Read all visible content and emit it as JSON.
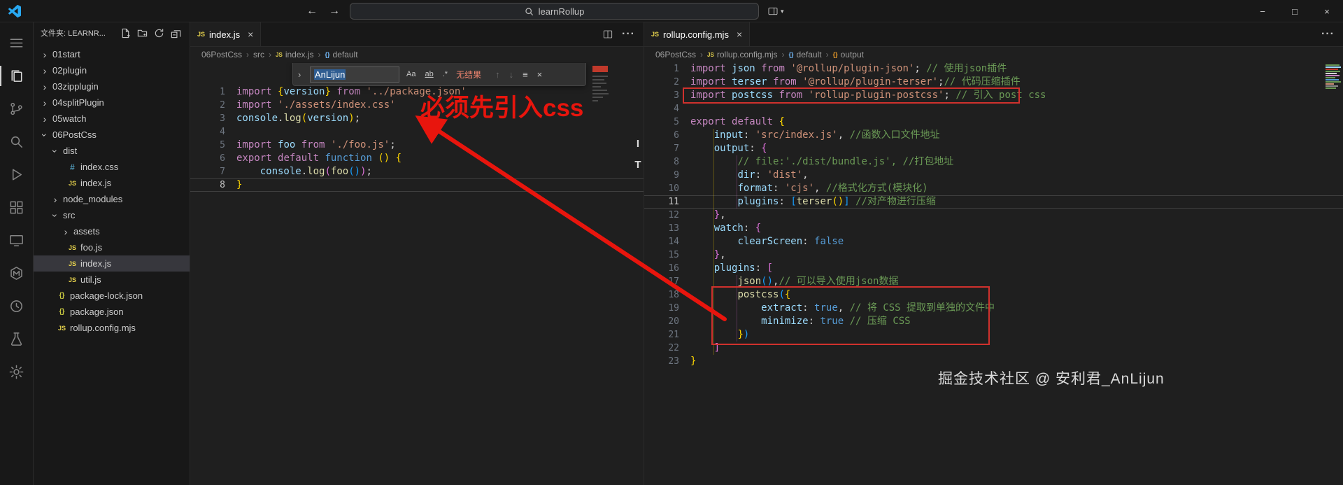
{
  "icons": {
    "back": "←",
    "forward": "→",
    "chevron": "›",
    "chevron_down": "▾",
    "dots": "···",
    "close": "×",
    "find_prev": "↑",
    "find_next": "↓",
    "find_selection": "≡",
    "match_case": "Aa",
    "whole_word": "ab",
    "regex": ".*",
    "minimize": "−",
    "maximize": "□",
    "window_close": "×",
    "scroll_mark_1": "I",
    "scroll_mark_2": "T",
    "js_badge": "JS",
    "css_badge": "#",
    "json_badge": "{}",
    "sym_badge": "{}"
  },
  "titlebar": {
    "search_value": "learnRollup"
  },
  "activity_bar": {
    "items": [
      "menu-icon",
      "explorer-icon",
      "source-control-icon",
      "search-icon",
      "run-debug-icon",
      "extensions-icon",
      "remote-explorer-icon",
      "extension-hex-m-icon",
      "extension-circle-icon",
      "testing-icon",
      "settings-gear-icon"
    ]
  },
  "explorer": {
    "header": "文件夹: LEARNR...",
    "tree": [
      {
        "label": "01start",
        "level": 0,
        "kind": "folder",
        "expanded": false
      },
      {
        "label": "02plugin",
        "level": 0,
        "kind": "folder",
        "expanded": false
      },
      {
        "label": "03zipplugin",
        "level": 0,
        "kind": "folder",
        "expanded": false
      },
      {
        "label": "04splitPlugin",
        "level": 0,
        "kind": "folder",
        "expanded": false
      },
      {
        "label": "05watch",
        "level": 0,
        "kind": "folder",
        "expanded": false
      },
      {
        "label": "06PostCss",
        "level": 0,
        "kind": "folder",
        "expanded": true
      },
      {
        "label": "dist",
        "level": 1,
        "kind": "folder",
        "expanded": true
      },
      {
        "label": "index.css",
        "level": 2,
        "kind": "file",
        "icon": "css"
      },
      {
        "label": "index.js",
        "level": 2,
        "kind": "file",
        "icon": "js"
      },
      {
        "label": "node_modules",
        "level": 1,
        "kind": "folder",
        "expanded": false
      },
      {
        "label": "src",
        "level": 1,
        "kind": "folder",
        "expanded": true
      },
      {
        "label": "assets",
        "level": 2,
        "kind": "folder",
        "expanded": false
      },
      {
        "label": "foo.js",
        "level": 2,
        "kind": "file",
        "icon": "js"
      },
      {
        "label": "index.js",
        "level": 2,
        "kind": "file",
        "icon": "js",
        "selected": true
      },
      {
        "label": "util.js",
        "level": 2,
        "kind": "file",
        "icon": "js"
      },
      {
        "label": "package-lock.json",
        "level": 1,
        "kind": "file",
        "icon": "json"
      },
      {
        "label": "package.json",
        "level": 1,
        "kind": "file",
        "icon": "json"
      },
      {
        "label": "rollup.config.mjs",
        "level": 1,
        "kind": "file",
        "icon": "js"
      }
    ]
  },
  "left_editor": {
    "tab": "index.js",
    "breadcrumbs": [
      {
        "label": "06PostCss"
      },
      {
        "label": "src"
      },
      {
        "label": "index.js",
        "icon": "js"
      },
      {
        "label": "default",
        "icon": "sym"
      }
    ],
    "find": {
      "query": "AnLijun",
      "status": "无结果"
    },
    "current_line": 8,
    "lines": [
      {
        "n": 1,
        "s": [
          [
            "kw",
            "import "
          ],
          [
            "b1",
            "{"
          ],
          [
            "id",
            "version"
          ],
          [
            "b1",
            "}"
          ],
          [
            "pln",
            " "
          ],
          [
            "kw",
            "from"
          ],
          [
            "pln",
            " "
          ],
          [
            "str",
            "'../package.json'"
          ]
        ]
      },
      {
        "n": 2,
        "s": [
          [
            "kw",
            "import "
          ],
          [
            "str",
            "'./assets/index.css'"
          ]
        ]
      },
      {
        "n": 3,
        "s": [
          [
            "id",
            "console"
          ],
          [
            "pln",
            "."
          ],
          [
            "fn",
            "log"
          ],
          [
            "b1",
            "("
          ],
          [
            "id",
            "version"
          ],
          [
            "b1",
            ")"
          ],
          [
            "pln",
            ";"
          ]
        ]
      },
      {
        "n": 4,
        "s": []
      },
      {
        "n": 5,
        "s": [
          [
            "kw",
            "import "
          ],
          [
            "id",
            "foo"
          ],
          [
            "kw",
            " from "
          ],
          [
            "str",
            "'./foo.js'"
          ],
          [
            "pln",
            ";"
          ]
        ]
      },
      {
        "n": 6,
        "s": [
          [
            "kw",
            "export "
          ],
          [
            "kw",
            "default "
          ],
          [
            "ctl",
            "function"
          ],
          [
            "pln",
            " "
          ],
          [
            "b1",
            "()"
          ],
          [
            "pln",
            " "
          ],
          [
            "b1",
            "{"
          ]
        ]
      },
      {
        "n": 7,
        "s": [
          [
            "pln",
            "    "
          ],
          [
            "id",
            "console"
          ],
          [
            "pln",
            "."
          ],
          [
            "fn",
            "log"
          ],
          [
            "b2",
            "("
          ],
          [
            "fn",
            "foo"
          ],
          [
            "b3",
            "()"
          ],
          [
            "b2",
            ")"
          ],
          [
            "pln",
            ";"
          ]
        ]
      },
      {
        "n": 8,
        "s": [
          [
            "b1",
            "}"
          ]
        ]
      }
    ]
  },
  "right_editor": {
    "tab": "rollup.config.mjs",
    "breadcrumbs": [
      {
        "label": "06PostCss"
      },
      {
        "label": "rollup.config.mjs",
        "icon": "js"
      },
      {
        "label": "default",
        "icon": "sym"
      },
      {
        "label": "output",
        "icon": "sym2"
      }
    ],
    "current_line": 11,
    "lines": [
      {
        "n": 1,
        "s": [
          [
            "kw",
            "import "
          ],
          [
            "id",
            "json"
          ],
          [
            "kw",
            " from "
          ],
          [
            "str",
            "'@rollup/plugin-json'"
          ],
          [
            "pln",
            "; "
          ],
          [
            "cm",
            "// 使用json插件"
          ]
        ]
      },
      {
        "n": 2,
        "s": [
          [
            "kw",
            "import "
          ],
          [
            "id",
            "terser"
          ],
          [
            "kw",
            " from "
          ],
          [
            "str",
            "'@rollup/plugin-terser'"
          ],
          [
            "pln",
            ";"
          ],
          [
            "cm",
            "// 代码压缩插件"
          ]
        ]
      },
      {
        "n": 3,
        "s": [
          [
            "kw",
            "import "
          ],
          [
            "id",
            "postcss"
          ],
          [
            "kw",
            " from "
          ],
          [
            "str",
            "'rollup-plugin-postcss'"
          ],
          [
            "pln",
            "; "
          ],
          [
            "cm",
            "// 引入 post css"
          ]
        ]
      },
      {
        "n": 4,
        "s": []
      },
      {
        "n": 5,
        "s": [
          [
            "kw",
            "export "
          ],
          [
            "kw",
            "default "
          ],
          [
            "b1",
            "{"
          ]
        ]
      },
      {
        "n": 6,
        "s": [
          [
            "pln",
            "    "
          ],
          [
            "id",
            "input"
          ],
          [
            "pln",
            ": "
          ],
          [
            "str",
            "'src/index.js'"
          ],
          [
            "pln",
            ", "
          ],
          [
            "cm",
            "//函数入口文件地址"
          ]
        ]
      },
      {
        "n": 7,
        "s": [
          [
            "pln",
            "    "
          ],
          [
            "id",
            "output"
          ],
          [
            "pln",
            ": "
          ],
          [
            "b2",
            "{"
          ]
        ]
      },
      {
        "n": 8,
        "s": [
          [
            "pln",
            "        "
          ],
          [
            "cm",
            "// file:'./dist/bundle.js', //打包地址"
          ]
        ]
      },
      {
        "n": 9,
        "s": [
          [
            "pln",
            "        "
          ],
          [
            "id",
            "dir"
          ],
          [
            "pln",
            ": "
          ],
          [
            "str",
            "'dist'"
          ],
          [
            "pln",
            ","
          ]
        ]
      },
      {
        "n": 10,
        "s": [
          [
            "pln",
            "        "
          ],
          [
            "id",
            "format"
          ],
          [
            "pln",
            ": "
          ],
          [
            "str",
            "'cjs'"
          ],
          [
            "pln",
            ", "
          ],
          [
            "cm",
            "//格式化方式(模块化)"
          ]
        ]
      },
      {
        "n": 11,
        "s": [
          [
            "pln",
            "        "
          ],
          [
            "id",
            "plugins"
          ],
          [
            "pln",
            ": "
          ],
          [
            "b3",
            "["
          ],
          [
            "fn",
            "terser"
          ],
          [
            "b1",
            "()"
          ],
          [
            "b3",
            "]"
          ],
          [
            "pln",
            " "
          ],
          [
            "cm",
            "//对产物进行压缩"
          ]
        ]
      },
      {
        "n": 12,
        "s": [
          [
            "pln",
            "    "
          ],
          [
            "b2",
            "}"
          ],
          [
            "pln",
            ","
          ]
        ]
      },
      {
        "n": 13,
        "s": [
          [
            "pln",
            "    "
          ],
          [
            "id",
            "watch"
          ],
          [
            "pln",
            ": "
          ],
          [
            "b2",
            "{"
          ]
        ]
      },
      {
        "n": 14,
        "s": [
          [
            "pln",
            "        "
          ],
          [
            "id",
            "clearScreen"
          ],
          [
            "pln",
            ": "
          ],
          [
            "ctl",
            "false"
          ]
        ]
      },
      {
        "n": 15,
        "s": [
          [
            "pln",
            "    "
          ],
          [
            "b2",
            "}"
          ],
          [
            "pln",
            ","
          ]
        ]
      },
      {
        "n": 16,
        "s": [
          [
            "pln",
            "    "
          ],
          [
            "id",
            "plugins"
          ],
          [
            "pln",
            ": "
          ],
          [
            "b2",
            "["
          ]
        ]
      },
      {
        "n": 17,
        "s": [
          [
            "pln",
            "        "
          ],
          [
            "fn",
            "json"
          ],
          [
            "b3",
            "()"
          ],
          [
            "pln",
            ","
          ],
          [
            "cm",
            "// 可以导入使用json数据"
          ]
        ]
      },
      {
        "n": 18,
        "s": [
          [
            "pln",
            "        "
          ],
          [
            "fn",
            "postcss"
          ],
          [
            "b3",
            "("
          ],
          [
            "b1",
            "{"
          ]
        ]
      },
      {
        "n": 19,
        "s": [
          [
            "pln",
            "            "
          ],
          [
            "id",
            "extract"
          ],
          [
            "pln",
            ": "
          ],
          [
            "ctl",
            "true"
          ],
          [
            "pln",
            ", "
          ],
          [
            "cm",
            "// 将 CSS 提取到单独的文件中"
          ]
        ]
      },
      {
        "n": 20,
        "s": [
          [
            "pln",
            "            "
          ],
          [
            "id",
            "minimize"
          ],
          [
            "pln",
            ": "
          ],
          [
            "ctl",
            "true"
          ],
          [
            "pln",
            " "
          ],
          [
            "cm",
            "// 压缩 CSS"
          ]
        ]
      },
      {
        "n": 21,
        "s": [
          [
            "pln",
            "        "
          ],
          [
            "b1",
            "}"
          ],
          [
            "b3",
            ")"
          ]
        ]
      },
      {
        "n": 22,
        "s": [
          [
            "pln",
            "    "
          ],
          [
            "b2",
            "]"
          ]
        ]
      },
      {
        "n": 23,
        "s": [
          [
            "b1",
            "}"
          ]
        ]
      }
    ]
  },
  "annotation": {
    "text": "必须先引入css"
  },
  "watermark": "掘金技术社区 @ 安利君_AnLijun"
}
